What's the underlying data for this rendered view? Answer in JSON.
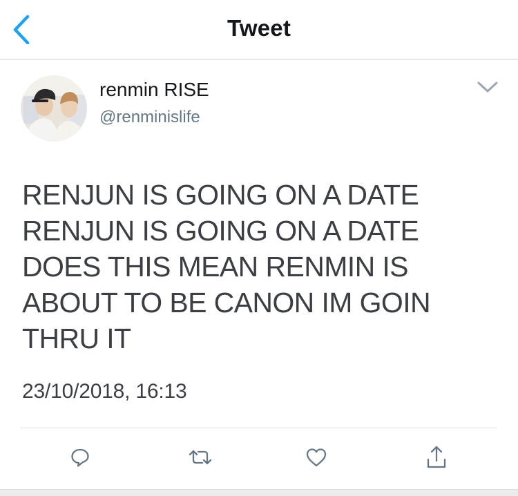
{
  "header": {
    "title": "Tweet",
    "back_icon": "chevron-left-icon"
  },
  "author": {
    "display_name": "renmin RISE",
    "handle": "@renminislife",
    "avatar": "avatar-photo",
    "menu_icon": "chevron-down-icon"
  },
  "tweet": {
    "lines": [
      "RENJUN IS GOING ON A DATE",
      "RENJUN IS GOING ON A DATE",
      "DOES THIS MEAN RENMIN IS",
      "ABOUT TO BE CANON IM GOIN",
      "THRU IT"
    ],
    "timestamp": "23/10/2018, 16:13"
  },
  "actions": [
    {
      "name": "reply",
      "icon": "reply-icon"
    },
    {
      "name": "retweet",
      "icon": "retweet-icon"
    },
    {
      "name": "like",
      "icon": "heart-icon"
    },
    {
      "name": "share",
      "icon": "share-icon"
    }
  ],
  "colors": {
    "accent": "#1da1f2",
    "icon_gray": "#657786",
    "text": "#14171a",
    "divider": "#d9dde1"
  }
}
